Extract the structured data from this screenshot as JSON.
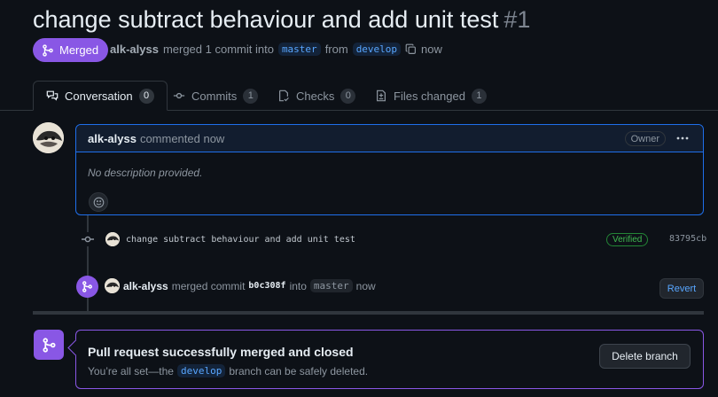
{
  "pr": {
    "title": "change subtract behaviour and add unit test",
    "number": "#1",
    "state_label": "Merged",
    "author": "alk-alyss",
    "merged_text": "merged 1 commit into",
    "base_branch": "master",
    "from_text": "from",
    "head_branch": "develop",
    "time": "now"
  },
  "tabs": [
    {
      "label": "Conversation",
      "count": "0",
      "icon": "comment-discussion-icon"
    },
    {
      "label": "Commits",
      "count": "1",
      "icon": "git-commit-icon"
    },
    {
      "label": "Checks",
      "count": "0",
      "icon": "checklist-icon"
    },
    {
      "label": "Files changed",
      "count": "1",
      "icon": "file-diff-icon"
    }
  ],
  "comment": {
    "author": "alk-alyss",
    "action": "commented now",
    "badge": "Owner",
    "body": "No description provided."
  },
  "commit": {
    "message": "change subtract behaviour and add unit test",
    "verified": "Verified",
    "sha": "83795cb"
  },
  "merge_event": {
    "author": "alk-alyss",
    "text": "merged commit",
    "sha": "b0c308f",
    "into": "into",
    "branch": "master",
    "time": "now",
    "revert_label": "Revert"
  },
  "merged_box": {
    "title": "Pull request successfully merged and closed",
    "sub_before": "You’re all set—the",
    "branch": "develop",
    "sub_after": "branch can be safely deleted.",
    "button": "Delete branch"
  },
  "colors": {
    "merged": "#8957e5",
    "link": "#58a6ff",
    "verified": "#3fb950",
    "comment_border": "#1f6feb"
  }
}
